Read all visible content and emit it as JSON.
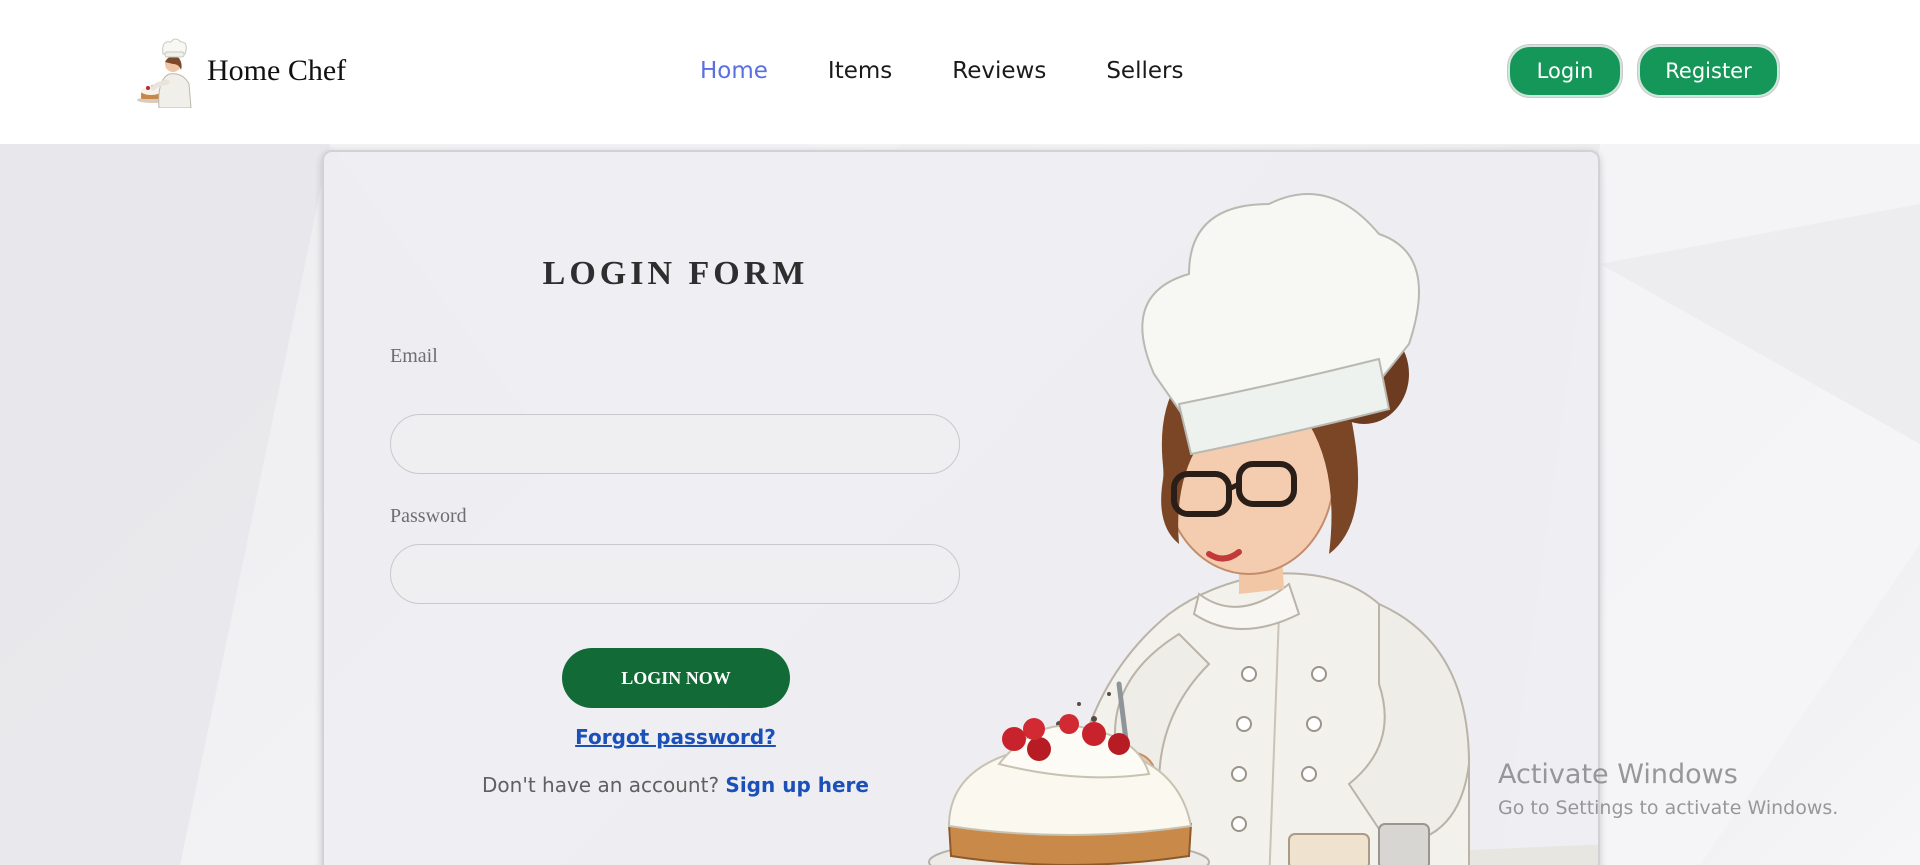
{
  "header": {
    "brand_name": "Home Chef",
    "nav": [
      {
        "label": "Home",
        "active": true
      },
      {
        "label": "Items",
        "active": false
      },
      {
        "label": "Reviews",
        "active": false
      },
      {
        "label": "Sellers",
        "active": false
      }
    ],
    "login_label": "Login",
    "register_label": "Register"
  },
  "form": {
    "title": "LOGIN FORM",
    "email_label": "Email",
    "email_value": "",
    "password_label": "Password",
    "password_value": "",
    "submit_label": "LOGIN NOW",
    "forgot_label": "Forgot password?",
    "signup_prompt": "Don't have an account?",
    "signup_link": "Sign up here"
  },
  "watermark": {
    "title": "Activate Windows",
    "subtitle": "Go to Settings to activate Windows."
  },
  "colors": {
    "accent_green": "#16975a",
    "button_dark_green": "#126b36",
    "nav_active": "#5a6fe0",
    "link_blue": "#1a50b8"
  },
  "icons": {
    "logo": "chef-logo-icon",
    "illustration": "chef-decorating-cake-illustration"
  }
}
